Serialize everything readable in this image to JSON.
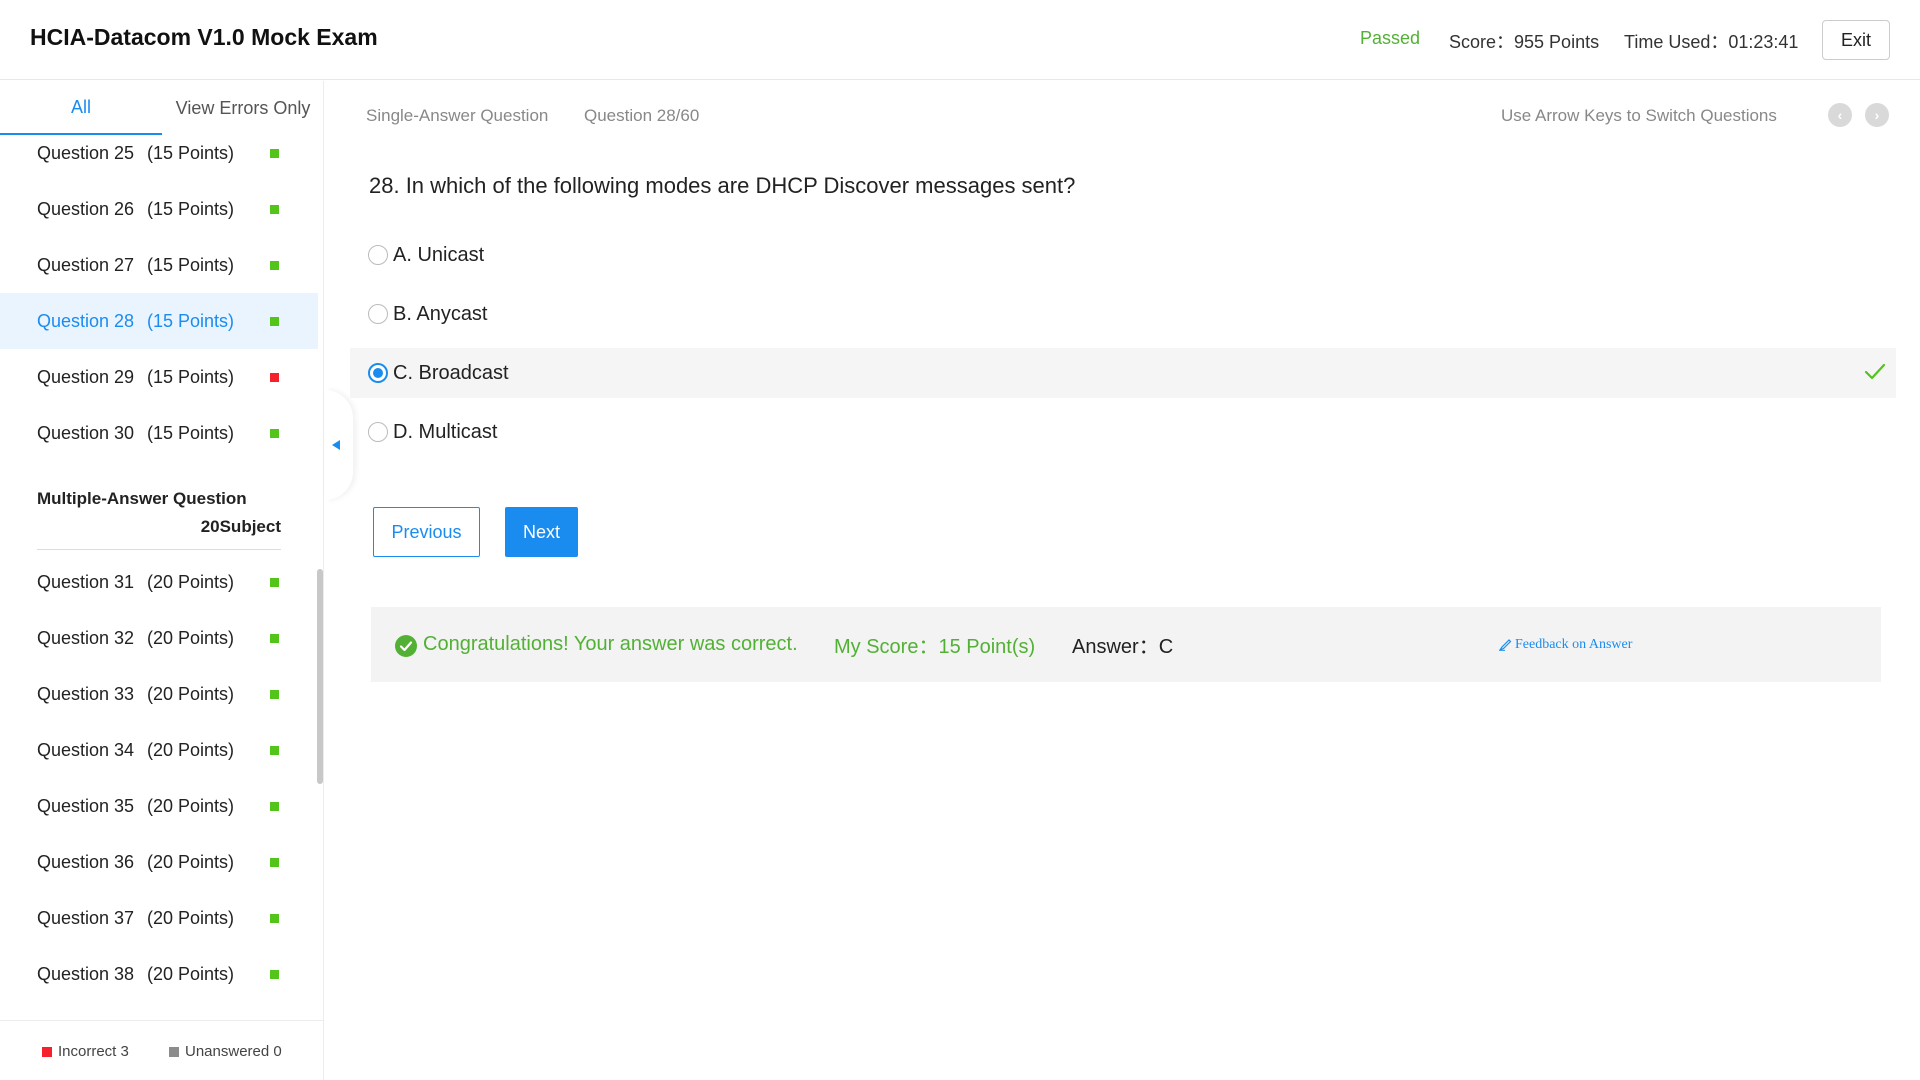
{
  "header": {
    "title": "HCIA-Datacom V1.0 Mock Exam",
    "status": "Passed",
    "score": "Score：955 Points",
    "time_used": "Time Used：01:23:41",
    "exit_label": "Exit"
  },
  "sidebar": {
    "tabs": [
      {
        "label": "All",
        "active": true
      },
      {
        "label": "View Errors Only",
        "active": false
      }
    ],
    "questions_a": [
      {
        "name": "Question 25",
        "points": "(15 Points)",
        "status": "correct"
      },
      {
        "name": "Question 26",
        "points": "(15 Points)",
        "status": "correct"
      },
      {
        "name": "Question 27",
        "points": "(15 Points)",
        "status": "correct"
      },
      {
        "name": "Question 28",
        "points": "(15 Points)",
        "status": "correct",
        "current": true
      },
      {
        "name": "Question 29",
        "points": "(15 Points)",
        "status": "incorrect"
      },
      {
        "name": "Question 30",
        "points": "(15 Points)",
        "status": "correct"
      }
    ],
    "section": {
      "title": "Multiple-Answer Question",
      "subtitle": "20Subject"
    },
    "questions_b": [
      {
        "name": "Question 31",
        "points": "(20 Points)",
        "status": "correct"
      },
      {
        "name": "Question 32",
        "points": "(20 Points)",
        "status": "correct"
      },
      {
        "name": "Question 33",
        "points": "(20 Points)",
        "status": "correct"
      },
      {
        "name": "Question 34",
        "points": "(20 Points)",
        "status": "correct"
      },
      {
        "name": "Question 35",
        "points": "(20 Points)",
        "status": "correct"
      },
      {
        "name": "Question 36",
        "points": "(20 Points)",
        "status": "correct"
      },
      {
        "name": "Question 37",
        "points": "(20 Points)",
        "status": "correct"
      },
      {
        "name": "Question 38",
        "points": "(20 Points)",
        "status": "correct"
      }
    ],
    "legend": {
      "incorrect": "Incorrect 3",
      "unanswered": "Unanswered 0"
    }
  },
  "main": {
    "question_type": "Single-Answer Question",
    "question_index": "Question 28/60",
    "nav_hint": "Use Arrow Keys to Switch Questions",
    "question_text": "28. In which of the following modes are DHCP Discover messages sent?",
    "options": [
      {
        "label": "A. Unicast",
        "selected": false,
        "correct": false
      },
      {
        "label": "B. Anycast",
        "selected": false,
        "correct": false
      },
      {
        "label": "C. Broadcast",
        "selected": true,
        "correct": true
      },
      {
        "label": "D. Multicast",
        "selected": false,
        "correct": false
      }
    ],
    "prev_label": "Previous",
    "next_label": "Next",
    "result": {
      "message": "Congratulations! Your answer was correct.",
      "my_score": "My Score：15 Point(s)",
      "answer": "Answer：C",
      "feedback": "Feedback on Answer"
    }
  },
  "colors": {
    "accent": "#1a8cf0",
    "success": "#52b135",
    "error": "#f5222d"
  }
}
